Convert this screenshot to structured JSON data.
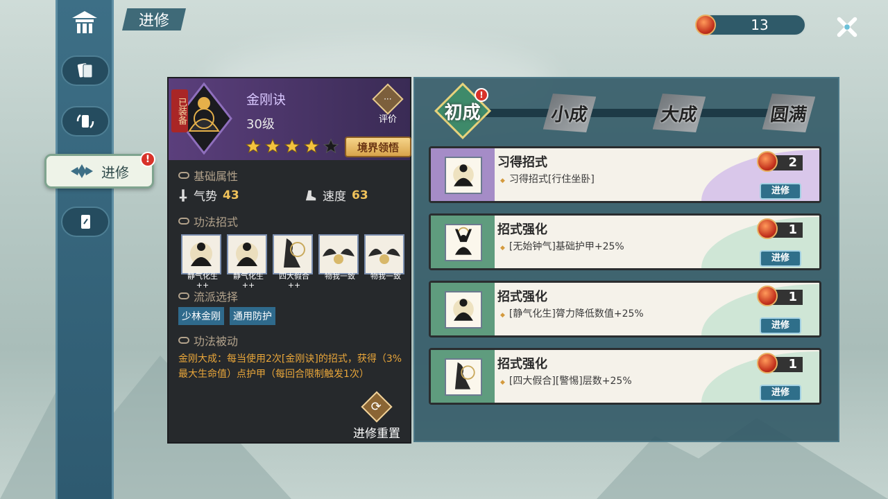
{
  "header": {
    "title": "进修",
    "currency_value": "13"
  },
  "sidebar": {
    "active_label": "进修",
    "alert_mark": "!"
  },
  "skill": {
    "equipped_label": "已装备",
    "name": "金刚诀",
    "level": "30级",
    "stars_filled": 4,
    "stars_total": 5,
    "review_label": "评价",
    "realm_button": "境界领悟"
  },
  "sections": {
    "base_attr": "基础属性",
    "moves": "功法招式",
    "school": "流派选择",
    "passive": "功法被动"
  },
  "stats": [
    {
      "label": "气势",
      "value": "43"
    },
    {
      "label": "速度",
      "value": "63"
    }
  ],
  "moves": [
    {
      "label": "静气化生",
      "suffix": "++"
    },
    {
      "label": "静气化生",
      "suffix": "++"
    },
    {
      "label": "四大假合",
      "suffix": "++"
    },
    {
      "label": "物我一致",
      "suffix": ""
    },
    {
      "label": "物我一致",
      "suffix": ""
    }
  ],
  "school_tags": [
    "少林金刚",
    "通用防护"
  ],
  "passive_text": "金刚大成：每当使用2次[金刚诀]的招式，获得（3%最大生命值）点护甲（每回合限制触发1次）",
  "reset_label": "进修重置",
  "stages": [
    {
      "label": "初成",
      "active": true,
      "alert": true
    },
    {
      "label": "小成",
      "active": false
    },
    {
      "label": "大成",
      "active": false
    },
    {
      "label": "圆满",
      "active": false
    }
  ],
  "cards": [
    {
      "title": "习得招式",
      "desc": "习得招式[行住坐卧]",
      "cost": "2",
      "button": "进修",
      "band_color": "#a58cc7",
      "wave_color": "#d9c7ea"
    },
    {
      "title": "招式强化",
      "desc": "[无始钟气]基础护甲+25%",
      "cost": "1",
      "button": "进修",
      "band_color": "#5f9c7e",
      "wave_color": "#cfe6d6"
    },
    {
      "title": "招式强化",
      "desc": "[静气化生]膂力降低数值+25%",
      "cost": "1",
      "button": "进修",
      "band_color": "#5f9c7e",
      "wave_color": "#cfe6d6"
    },
    {
      "title": "招式强化",
      "desc": "[四大假合][警惕]层数+25%",
      "cost": "1",
      "button": "进修",
      "band_color": "#5f9c7e",
      "wave_color": "#cfe6d6"
    }
  ],
  "colors": {
    "accent_gold": "#f0c25a",
    "passive_orange": "#e9a63a",
    "panel_dark": "#26292c",
    "panel_teal": "#2f5664"
  }
}
